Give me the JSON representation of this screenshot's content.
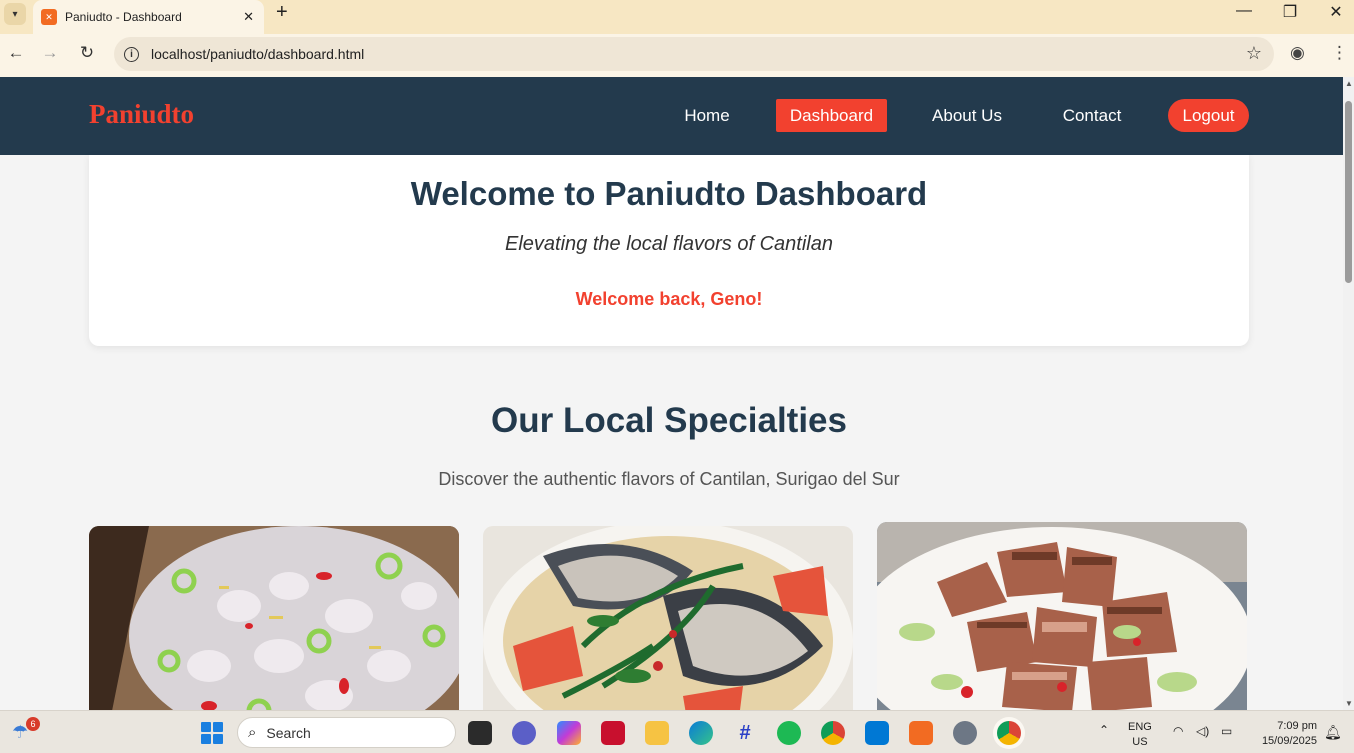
{
  "browser": {
    "tab_title": "Paniudto - Dashboard",
    "url": "localhost/paniudto/dashboard.html"
  },
  "site": {
    "brand": "Paniudto",
    "nav": [
      {
        "label": "Home"
      },
      {
        "label": "Dashboard",
        "active": true
      },
      {
        "label": "About Us"
      },
      {
        "label": "Contact"
      },
      {
        "label": "Logout"
      }
    ],
    "accent_color": "#f2412f",
    "nav_bg_color": "#233a4d"
  },
  "welcome": {
    "title": "Welcome to Paniudto Dashboard",
    "subtitle": "Elevating the local flavors of Cantilan",
    "user_greeting": "Welcome back, Geno!"
  },
  "specialties": {
    "title": "Our Local Specialties",
    "subtitle": "Discover the authentic flavors of Cantilan, Surigao del Sur",
    "cards": [
      {
        "image": "kinilaw-fish-salad-photo"
      },
      {
        "image": "fish-soup-photo"
      },
      {
        "image": "grilled-pork-salad-photo"
      }
    ]
  },
  "taskbar": {
    "weather_badge": "6",
    "search_label": "Search",
    "lang_line1": "ENG",
    "lang_line2": "US",
    "time": "7:09 pm",
    "date": "15/09/2025"
  }
}
